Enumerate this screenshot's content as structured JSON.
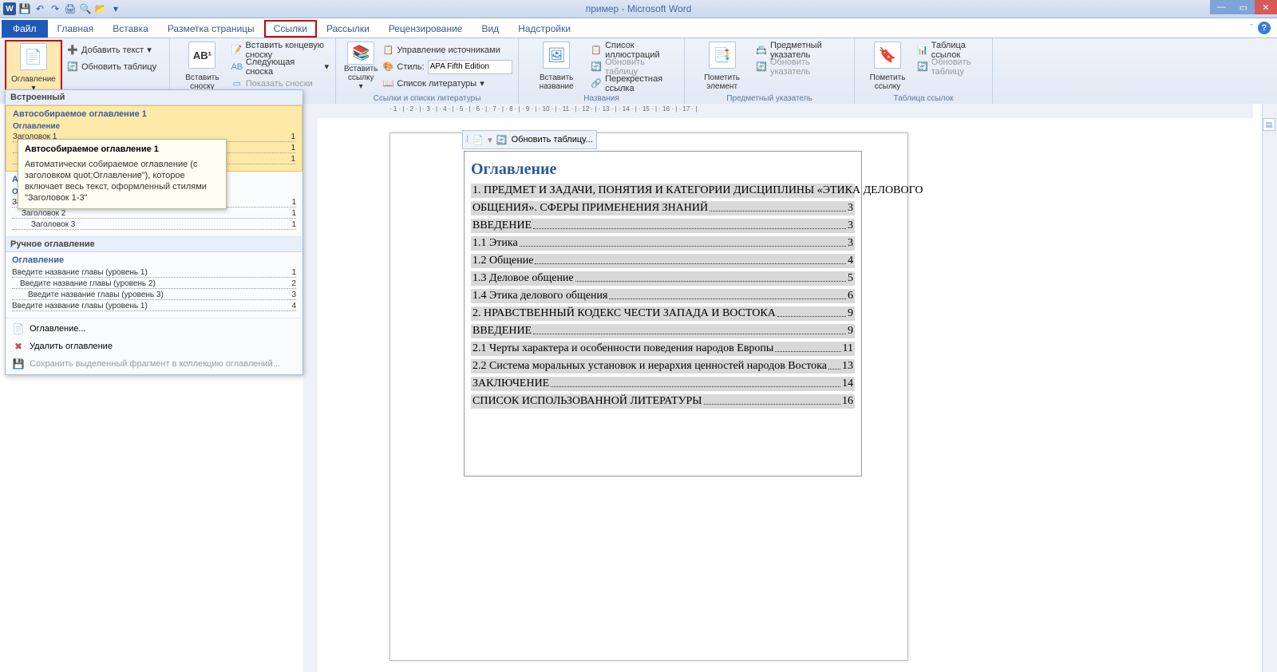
{
  "title": "пример - Microsoft Word",
  "qat": {
    "save": "💾",
    "undo": "↶",
    "redo": "↷",
    "print": "🖨",
    "preview": "🔍",
    "open": "📂",
    "dd": "▾"
  },
  "tabs": {
    "file": "Файл",
    "home": "Главная",
    "insert": "Вставка",
    "layout": "Разметка страницы",
    "references": "Ссылки",
    "mailings": "Рассылки",
    "review": "Рецензирование",
    "view": "Вид",
    "addins": "Надстройки"
  },
  "ribbon": {
    "toc": {
      "big": "Оглавление",
      "add_text": "Добавить текст",
      "update": "Обновить таблицу"
    },
    "footnote": {
      "big": "Вставить\nсноску",
      "insert_end": "Вставить концевую сноску",
      "next": "Следующая сноска",
      "show": "Показать сноски",
      "ab": "AB¹"
    },
    "citation": {
      "big": "Вставить\nссылку",
      "manage": "Управление источниками",
      "style_lbl": "Стиль:",
      "style_val": "APA Fifth Edition",
      "biblio": "Список литературы",
      "group": "Ссылки и списки литературы"
    },
    "caption": {
      "big": "Вставить\nназвание",
      "list": "Список иллюстраций",
      "update": "Обновить таблицу",
      "cross": "Перекрестная ссылка",
      "group": "Названия"
    },
    "index": {
      "big": "Пометить\nэлемент",
      "subject": "Предметный указатель",
      "update": "Обновить указатель",
      "group": "Предметный указатель"
    },
    "toa": {
      "big": "Пометить\nссылку",
      "table": "Таблица ссылок",
      "update": "Обновить таблицу",
      "group": "Таблица ссылок"
    }
  },
  "gallery": {
    "header": "Встроенный",
    "item1_title": "Автособираемое оглавление 1",
    "item2_title": "Автособираемое оглавление 2",
    "preview_title": "Оглавление",
    "preview_rows": [
      {
        "l": "Заголовок 1",
        "p": "1"
      },
      {
        "l": "Заголовок 2",
        "p": "1"
      },
      {
        "l": "Заголовок 3",
        "p": "1"
      }
    ],
    "manual_header": "Ручное оглавление",
    "manual_rows": [
      {
        "l": "Введите название главы (уровень 1)",
        "p": "1"
      },
      {
        "l": "Введите название главы (уровень 2)",
        "p": "2"
      },
      {
        "l": "Введите название главы (уровень 3)",
        "p": "3"
      },
      {
        "l": "Введите название главы (уровень 1)",
        "p": "4"
      }
    ],
    "footer": {
      "custom": "Оглавление...",
      "remove": "Удалить оглавление",
      "save": "Сохранить выделенный фрагмент в коллекцию оглавлений..."
    }
  },
  "tooltip": {
    "title": "Автособираемое оглавление 1",
    "body": "Автоматически собираемое оглавление (с заголовком quot;Оглавление\"), которое включает весь текст, оформленный стилями \"Заголовок 1-3\""
  },
  "doc": {
    "toolbar_update": "Обновить таблицу...",
    "toc_title": "Оглавление",
    "entries": [
      {
        "t": "1.     ПРЕДМЕТ И ЗАДАЧИ, ПОНЯТИЯ И КАТЕГОРИИ ДИСЦИПЛИНЫ «ЭТИКА ДЕЛОВОГО",
        "p": "",
        "nodots": true
      },
      {
        "t": "ОБЩЕНИЯ». СФЕРЫ ПРИМЕНЕНИЯ ЗНАНИЙ",
        "p": "3"
      },
      {
        "t": "ВВЕДЕНИЕ",
        "p": "3"
      },
      {
        "t": "1.1 Этика",
        "p": "3"
      },
      {
        "t": "1.2 Общение",
        "p": "4"
      },
      {
        "t": "1.3 Деловое общение",
        "p": "5"
      },
      {
        "t": "1.4 Этика делового общения",
        "p": "6"
      },
      {
        "t": "2.     НРАВСТВЕННЫЙ КОДЕКС ЧЕСТИ ЗАПАДА И ВОСТОКА",
        "p": "9"
      },
      {
        "t": "ВВЕДЕНИЕ",
        "p": "9"
      },
      {
        "t": "2.1 Черты характера и особенности поведения народов Европы",
        "p": "11"
      },
      {
        "t": "2.2 Система моральных установок и иерархия ценностей народов Востока",
        "p": "13"
      },
      {
        "t": "ЗАКЛЮЧЕНИЕ",
        "p": "14"
      },
      {
        "t": "СПИСОК ИСПОЛЬЗОВАННОЙ ЛИТЕРАТУРЫ",
        "p": "16"
      }
    ]
  },
  "ruler": " · 1 · | · 2 · | · 3 · | · 4 · | · 5 · | · 6 · | · 7 · | · 8 · | · 9 · | · 10 · | · 11 · | · 12 · | · 13 · | · 14 · | · 15 · | · 16 · | · 17 · |"
}
